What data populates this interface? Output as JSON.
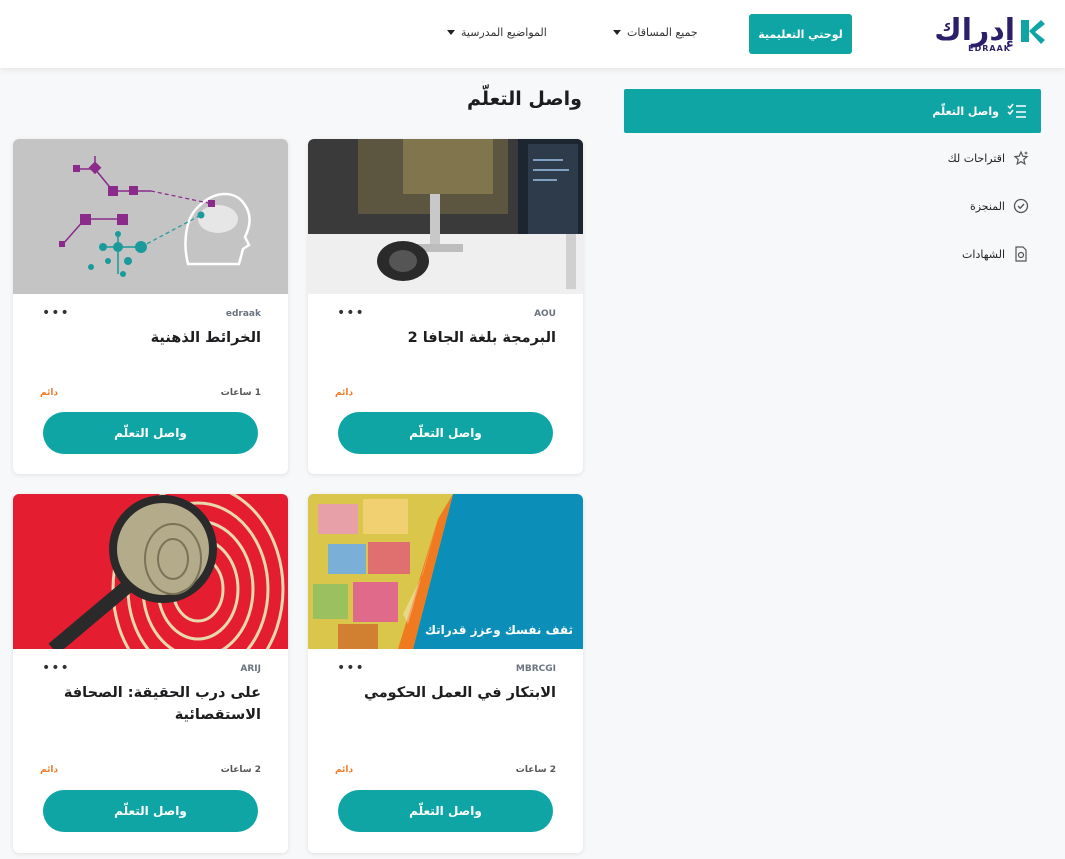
{
  "header": {
    "logo_text": "إدراك",
    "logo_sub": "EDRAAK",
    "dashboard_label": "لوحتي التعليمية",
    "nav_courses": "جميع المساقات",
    "nav_school": "المواضيع المدرسية"
  },
  "sidebar": {
    "items": [
      {
        "label": "واصل التعلّم",
        "icon": "list-check-icon",
        "active": true
      },
      {
        "label": "اقتراحات لك",
        "icon": "sparkle-star-icon"
      },
      {
        "label": "المنجزة",
        "icon": "badge-check-icon"
      },
      {
        "label": "الشهادات",
        "icon": "certificate-icon"
      }
    ]
  },
  "main": {
    "title": "واصل التعلّم",
    "cards": [
      {
        "provider": "AOU",
        "title": "البرمجة بلغة الجافا 2",
        "hours": "",
        "status": "دائم",
        "cta": "واصل التعلّم"
      },
      {
        "provider": "edraak",
        "title": "الخرائط الذهنية",
        "hours": "1 ساعات",
        "status": "دائم",
        "cta": "واصل التعلّم"
      },
      {
        "provider": "MBRCGI",
        "title": "الابتكار في العمل الحكومي",
        "hours": "2 ساعات",
        "status": "دائم",
        "cta": "واصل التعلّم",
        "banner": "ثقف نفسك وعزز قدراتك"
      },
      {
        "provider": "ARIJ",
        "title": "على درب الحقيقة: الصحافة الاستقصائية",
        "hours": "2 ساعات",
        "status": "دائم",
        "cta": "واصل التعلّم"
      }
    ]
  },
  "colors": {
    "accent": "#10a5a5",
    "brand": "#2b1f6b",
    "status": "#f07c2a"
  }
}
